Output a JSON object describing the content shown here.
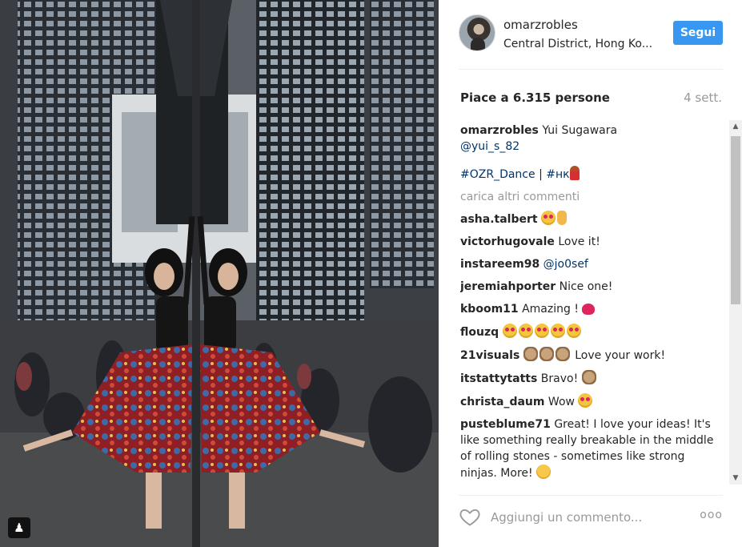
{
  "post": {
    "username": "omarzrobles",
    "location": "Central District, Hong Ko...",
    "follow_label": "Segui",
    "likes_text": "Piace a 6.315 persone",
    "time_ago": "4 sett."
  },
  "caption": {
    "username": "omarzrobles",
    "text": "Yui Sugawara",
    "mention": "@yui_s_82",
    "tag1": "#OZR_Dance",
    "separator": " | ",
    "tag2": "#нк"
  },
  "load_more": "carica altri commenti",
  "comments": [
    {
      "user": "asha.talbert",
      "text": "",
      "emoji": [
        "heart-eyes",
        "ok-hand"
      ]
    },
    {
      "user": "victorhugovale",
      "text": "Love it!",
      "emoji": []
    },
    {
      "user": "instareem98",
      "text": "",
      "mention": "@jo0sef",
      "emoji": []
    },
    {
      "user": "jeremiahporter",
      "text": "Nice one!",
      "emoji": []
    },
    {
      "user": "kboom11",
      "text": "Amazing !",
      "emoji": [
        "red-heart"
      ]
    },
    {
      "user": "flouzq",
      "text": "",
      "emoji": [
        "heart-eyes",
        "heart-eyes",
        "heart-eyes",
        "heart-eyes",
        "heart-eyes"
      ]
    },
    {
      "user": "21visuals",
      "text": "Love your work!",
      "emoji": [
        "clap",
        "clap",
        "clap"
      ]
    },
    {
      "user": "itstattytatts",
      "text": "Bravo!",
      "emoji": [
        "clap"
      ]
    },
    {
      "user": "christa_daum",
      "text": "Wow",
      "emoji": [
        "heart-eyes"
      ]
    },
    {
      "user": "pusteblume71",
      "text": "Great! I love your ideas! It's like something really breakable in the middle of rolling stones - sometimes like strong ninjas. More!",
      "emoji": [
        "blush"
      ]
    }
  ],
  "comment_box": {
    "placeholder": "Aggiungi un commento...",
    "more_label": "ooo"
  },
  "icons": {
    "like": "heart-outline-icon",
    "user_tag": "person-icon",
    "options": "more-options-icon"
  },
  "colors": {
    "follow_button": "#3897f0",
    "link": "#003569",
    "muted": "#999999"
  }
}
